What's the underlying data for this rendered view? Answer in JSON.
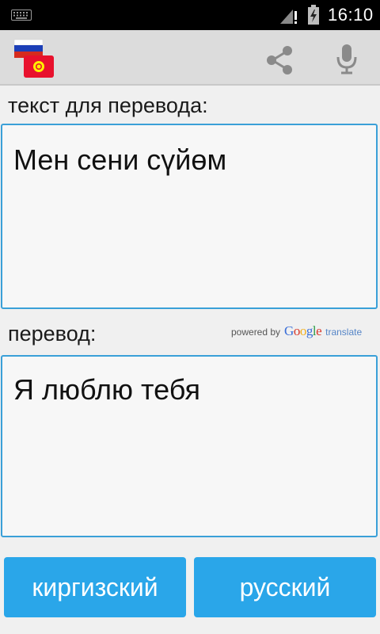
{
  "status_bar": {
    "time": "16:10",
    "icons": [
      "keyboard-icon",
      "signal-alert-icon",
      "battery-charging-icon"
    ]
  },
  "action_bar": {
    "flag_button": "russia-kyrgyzstan-flag-icon",
    "actions": [
      "share-icon",
      "microphone-icon"
    ]
  },
  "source": {
    "label": "текст для перевода:",
    "text": "Мен сени сүйөм"
  },
  "translation": {
    "label": "перевод:",
    "text": "Я люблю тебя",
    "powered_by": "powered by",
    "google": [
      "G",
      "o",
      "o",
      "g",
      "l",
      "e"
    ],
    "google_colors": [
      "#3b6fd8",
      "#d8392b",
      "#f2b01e",
      "#3b6fd8",
      "#2e9d48",
      "#d8392b"
    ],
    "translate_word": "translate"
  },
  "buttons": {
    "source_language": "киргизский",
    "target_language": "русский"
  },
  "colors": {
    "accent": "#2aa6e9",
    "textbox_border": "#3aa0d8",
    "action_bar": "#dcdcdc"
  }
}
